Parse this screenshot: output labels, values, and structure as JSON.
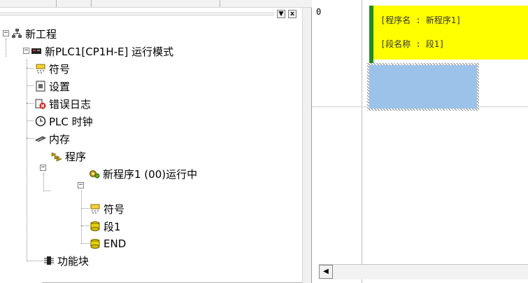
{
  "tree": {
    "root": {
      "label": "新工程",
      "icon": "network-icon"
    },
    "plc": {
      "label": "新PLC1[CP1H-E] 运行模式",
      "icon": "plc-device-icon"
    },
    "items": [
      {
        "label": "符号",
        "icon": "symbols-icon"
      },
      {
        "label": "设置",
        "icon": "settings-icon"
      },
      {
        "label": "错误日志",
        "icon": "error-log-icon"
      },
      {
        "label": "PLC 时钟",
        "icon": "clock-icon"
      },
      {
        "label": "内存",
        "icon": "memory-icon"
      }
    ],
    "programs": {
      "label": "程序",
      "icon": "programs-icon"
    },
    "program1": {
      "label": "新程序1 (00)运行中",
      "icon": "running-program-icon"
    },
    "program1_children": [
      {
        "label": "符号",
        "icon": "symbols-icon"
      },
      {
        "label": "段1",
        "icon": "section-icon"
      },
      {
        "label": "END",
        "icon": "section-icon"
      }
    ],
    "function_blocks": {
      "label": "功能块",
      "icon": "function-block-icon"
    },
    "expander_collapse": "−"
  },
  "pane_buttons": {
    "dropdown": "▼",
    "close": "x"
  },
  "ladder": {
    "rung_number": "0",
    "program_name_line": "[程序名 : 新程序1]",
    "section_name_line": "[段名称 : 段1]"
  },
  "scrollbar": {
    "left_arrow": "◀"
  },
  "colors": {
    "header_bg": "#ffff00",
    "rail": "#228b22",
    "rung_block": "#9bc3ea"
  }
}
